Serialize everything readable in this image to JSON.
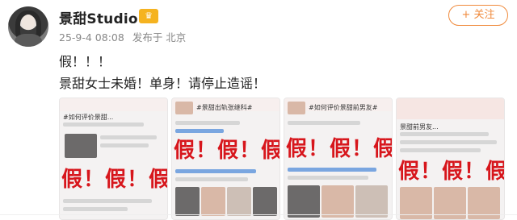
{
  "post": {
    "username": "景甜Studio",
    "vip_badge": "♛",
    "date": "25-9-4 08:08",
    "source": "发布于 北京",
    "follow_label": "+ 关注",
    "text_line1": "假！！！",
    "text_line2": "景甜女士未婚！单身！请停止造谣！"
  },
  "images": [
    {
      "caption": "#如何评价景甜...",
      "stamp": "假！假！假！",
      "stamp_color": "#d7161c"
    },
    {
      "caption": "#景甜出轨张继科#",
      "stamp": "假！假！假！",
      "stamp_color": "#d7161c"
    },
    {
      "caption": "#如何评价景甜前男友#",
      "stamp": "假！假！假！",
      "stamp_color": "#d7161c"
    },
    {
      "caption": "景甜前男友...",
      "stamp": "假！假！假！",
      "stamp_color": "#d7161c"
    }
  ],
  "colors": {
    "accent": "#f08a3c",
    "vip": "#f5b320",
    "stamp": "#d7161c"
  }
}
